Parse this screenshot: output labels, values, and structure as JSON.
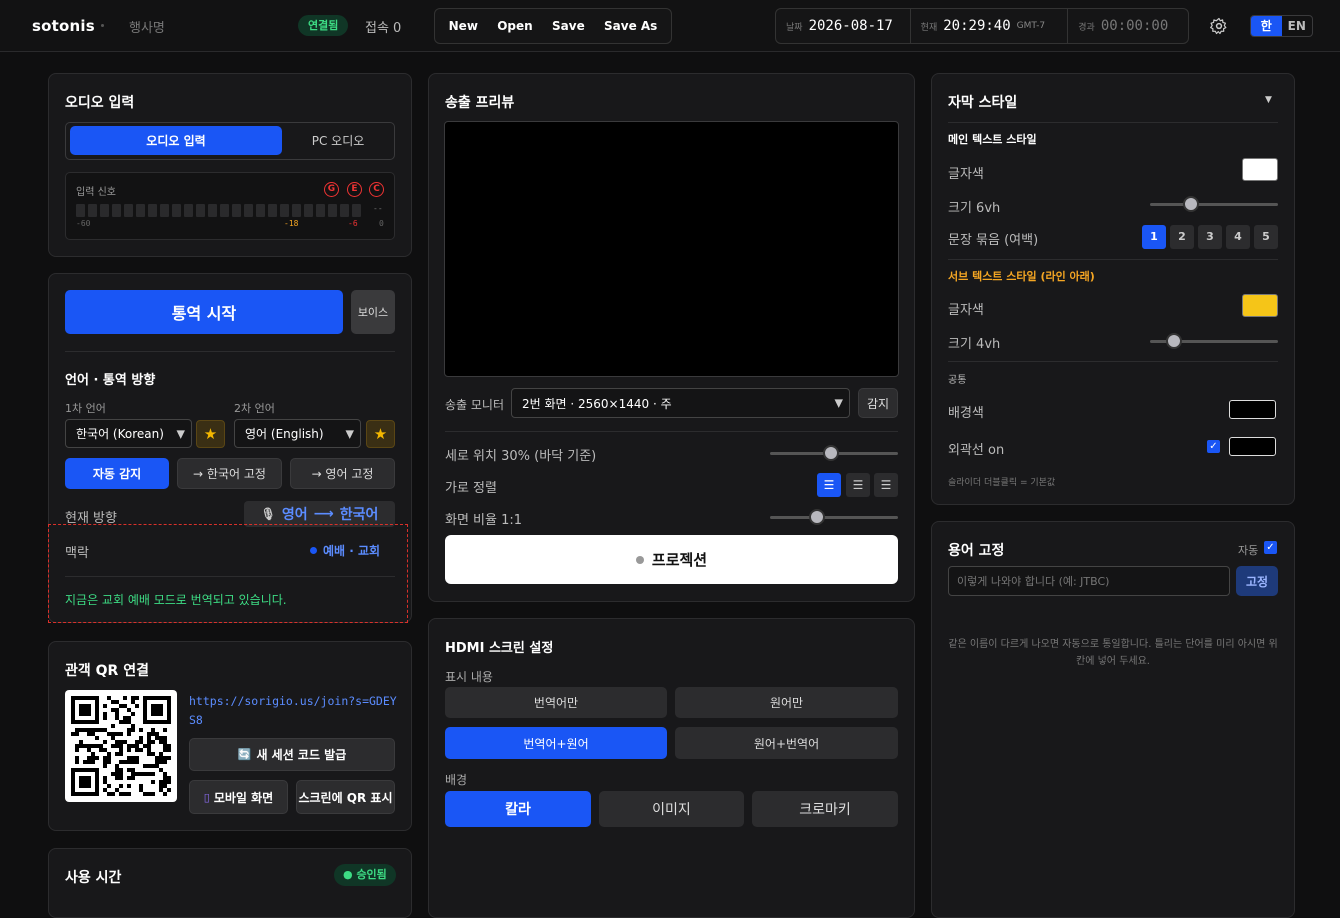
{
  "header": {
    "logo": "sotonis",
    "event_name": "행사명",
    "connection_badge": "연결됨",
    "connections": "접속 0",
    "file_menu": [
      "New",
      "Open",
      "Save",
      "Save As"
    ],
    "date_label": "날짜",
    "date_value": "2026-08-17",
    "now_label": "현재",
    "now_value": "20:29:40",
    "timezone": "GMT-7",
    "elapsed_label": "경과",
    "elapsed_value": "00:00:00",
    "lang_ko": "한",
    "lang_en": "EN",
    "lang_selected": "한"
  },
  "audio": {
    "title": "오디오 입력",
    "tab_input": "오디오 입력",
    "tab_pc": "PC 오디오",
    "signal_label": "입력 신호",
    "indicators": [
      "G",
      "E",
      "C"
    ],
    "scale": [
      "-60",
      "-18",
      "-6",
      "0"
    ],
    "level_readout": "--"
  },
  "translate": {
    "start_button": "통역 시작",
    "voice_button": "보이스",
    "lang_section": "언어 · 통역 방향",
    "primary_label": "1차 언어",
    "primary_value": "한국어 (Korean)",
    "secondary_label": "2차 언어",
    "secondary_value": "영어 (English)",
    "auto_detect": "자동 감지",
    "fix_korean": "→ 한국어 고정",
    "fix_english": "→ 영어 고정",
    "current_dir_label": "현재 방향",
    "dir_from": "영어",
    "dir_arrow": "⟶",
    "dir_to": "한국어",
    "context_label": "맥락",
    "context_value": "예배 · 교회",
    "context_message": "지금은 교회 예배 모드로 번역되고 있습니다."
  },
  "qr": {
    "title": "관객 QR 연결",
    "url": "https://sorigio.us/join?s=GDEYS8",
    "new_code": "새 세션 코드 발급",
    "mobile": "모바일 화면",
    "screen_qr": "스크린에 QR 표시"
  },
  "usage": {
    "title": "사용 시간",
    "badge": "승인됨"
  },
  "preview": {
    "title": "송출 프리뷰",
    "monitor_label": "송출 모니터",
    "monitor_value": "2번 화면 · 2560×1440 · 주",
    "detect_button": "감지",
    "vertical_label": "세로 위치 30% (바닥 기준)",
    "vertical_value": 0.48,
    "h_align_label": "가로 정렬",
    "ratio_label": "화면 비율 1:1",
    "ratio_value": 0.37,
    "projection_button": "프로젝션"
  },
  "hdmi": {
    "title": "HDMI 스크린 설정",
    "display_label": "표시 내용",
    "display_options": [
      "번역어만",
      "원어만",
      "번역어+원어",
      "원어+번역어"
    ],
    "display_selected": "번역어+원어",
    "bg_label": "배경",
    "bg_options": [
      "칼라",
      "이미지",
      "크로마키"
    ],
    "bg_selected": "칼라"
  },
  "style": {
    "title": "자막 스타일",
    "main_section": "메인 텍스트 스타일",
    "main_color_label": "글자색",
    "main_color": "#ffffff",
    "main_size_label": "크기 6vh",
    "main_size_value": 0.32,
    "group_label": "문장 묶음 (여백)",
    "group_options": [
      "1",
      "2",
      "3",
      "4",
      "5"
    ],
    "group_selected": "1",
    "sub_section": "서브 텍스트 스타일 (라인 아래)",
    "sub_color_label": "글자색",
    "sub_color": "#f5c518",
    "sub_size_label": "크기 4vh",
    "sub_size_value": 0.19,
    "common_section": "공통",
    "bg_color_label": "배경색",
    "bg_color": "#000000",
    "outline_label": "외곽선 on",
    "outline_color": "#000000",
    "hint": "슬라이더 더블클릭 = 기본값"
  },
  "glossary": {
    "title": "용어 고정",
    "auto_label": "자동",
    "input_placeholder": "이렇게 나와야 합니다 (예: JTBC)",
    "fix_button": "고정",
    "hint": "같은 이름이 다르게 나오면 자동으로 통일합니다. 틀리는 단어를 미리 아시면 위 칸에 넣어 두세요."
  },
  "colors": {
    "accent": "#1a56f5",
    "success": "#3ddc84",
    "warn": "#f5b800",
    "danger": "#e33333"
  }
}
